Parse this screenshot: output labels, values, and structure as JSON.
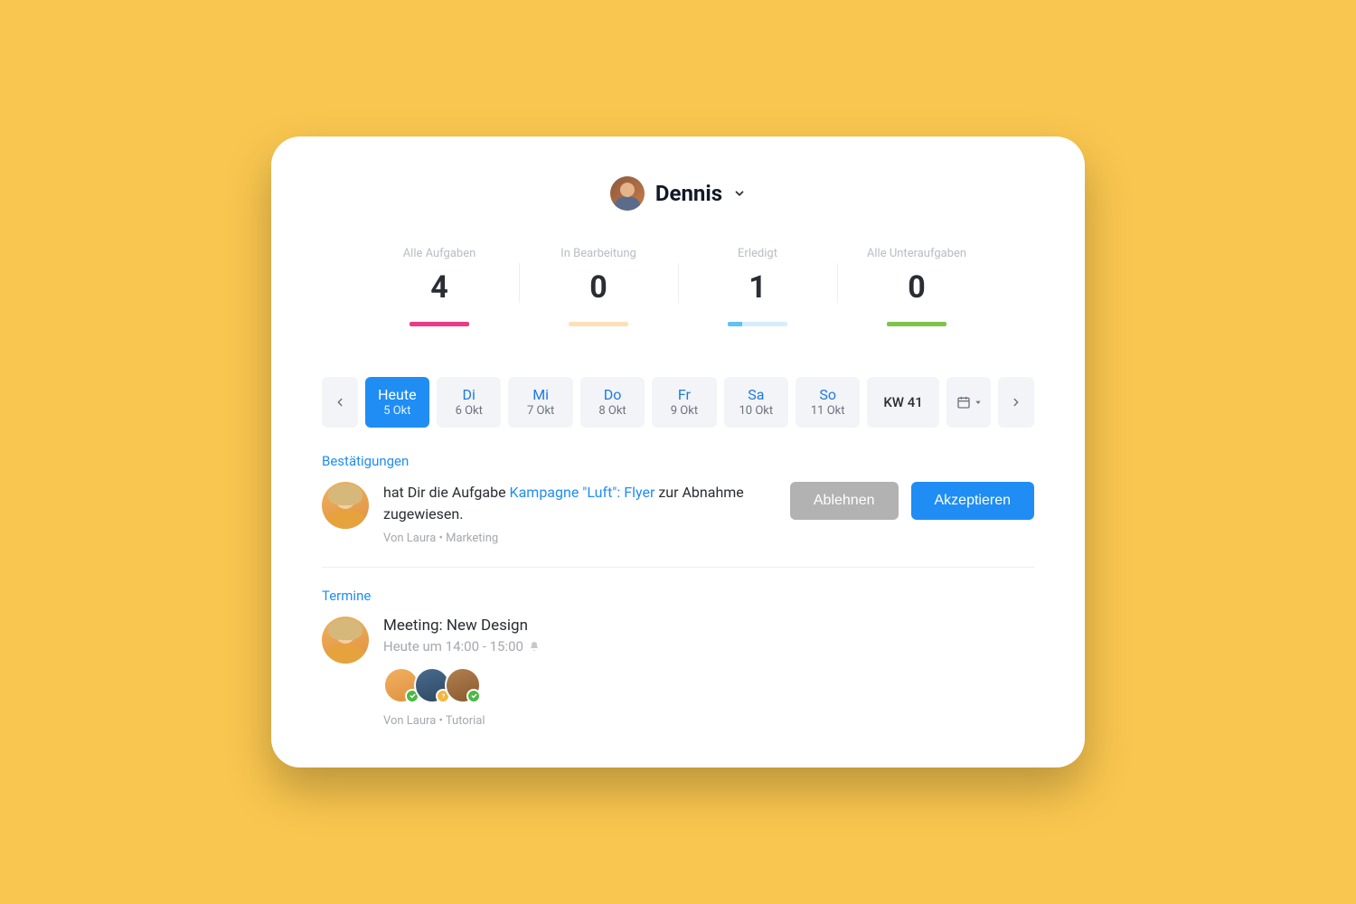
{
  "header": {
    "user_name": "Dennis"
  },
  "stats": [
    {
      "label": "Alle Aufgaben",
      "value": "4",
      "color": "pink"
    },
    {
      "label": "In Bearbeitung",
      "value": "0",
      "color": "cream"
    },
    {
      "label": "Erledigt",
      "value": "1",
      "color": "blue"
    },
    {
      "label": "Alle Unteraufgaben",
      "value": "0",
      "color": "green"
    }
  ],
  "days": [
    {
      "top": "Heute",
      "bot": "5 Okt",
      "active": true
    },
    {
      "top": "Di",
      "bot": "6 Okt",
      "active": false
    },
    {
      "top": "Mi",
      "bot": "7 Okt",
      "active": false
    },
    {
      "top": "Do",
      "bot": "8 Okt",
      "active": false
    },
    {
      "top": "Fr",
      "bot": "9 Okt",
      "active": false
    },
    {
      "top": "Sa",
      "bot": "10 Okt",
      "active": false
    },
    {
      "top": "So",
      "bot": "11 Okt",
      "active": false
    }
  ],
  "week_label": "KW 41",
  "sections": {
    "confirm_title": "Bestätigungen",
    "appt_title": "Termine"
  },
  "confirm": {
    "pre": "hat Dir die Aufgabe ",
    "link": "Kampagne \"Luft\": Flyer",
    "post": " zur Abnahme zugewiesen.",
    "meta": "Von Laura • Marketing",
    "decline": "Ablehnen",
    "accept": "Akzeptieren"
  },
  "appt": {
    "title": "Meeting: New Design",
    "time": "Heute um 14:00 - 15:00",
    "meta": "Von Laura • Tutorial",
    "attendees": [
      {
        "status": "ok"
      },
      {
        "status": "pending"
      },
      {
        "status": "ok"
      }
    ]
  }
}
